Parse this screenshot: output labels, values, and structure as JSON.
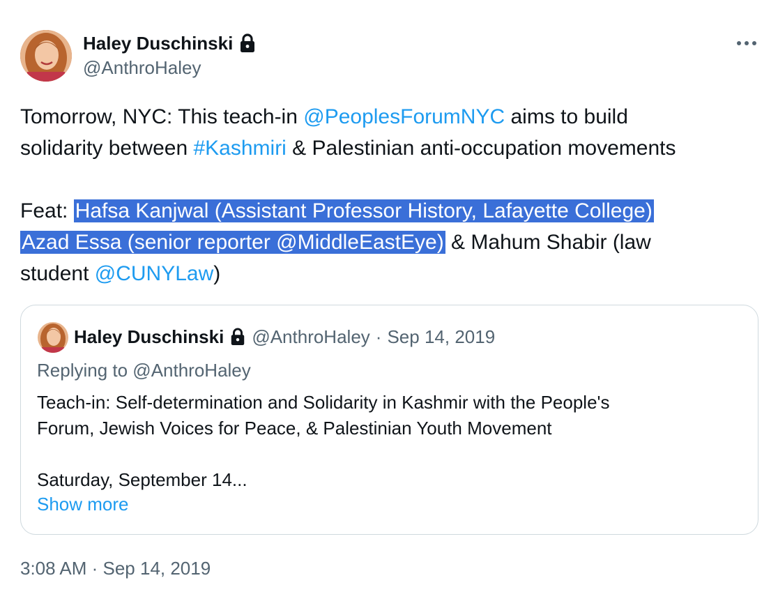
{
  "author": {
    "display_name": "Haley Duschinski",
    "handle": "@AnthroHaley",
    "protected_icon": "lock-icon",
    "avatar_icon": "avatar"
  },
  "more_icon": "more-icon",
  "tweet": {
    "line1_a": "Tomorrow, NYC: This teach-in ",
    "line1_link": "@PeoplesForumNYC",
    "line1_b": " aims to build",
    "line2_a": "solidarity between ",
    "line2_link": "#Kashmiri",
    "line2_b": " & Palestinian anti-occupation movements",
    "line4_a": "Feat: ",
    "line4_sel": "Hafsa Kanjwal (Assistant Professor History, Lafayette College)",
    "line5_sel_a": "Azad Essa (senior reporter ",
    "line5_sel_link": "@MiddleEastEye",
    "line5_sel_b": ")",
    "line5_b": " & Mahum Shabir (law",
    "line6_a": "student ",
    "line6_link": "@CUNYLaw",
    "line6_b": ")"
  },
  "quote": {
    "display_name": "Haley Duschinski",
    "handle": "@AnthroHaley",
    "separator": "·",
    "date": "Sep 14, 2019",
    "replying_to": "Replying to @AnthroHaley",
    "line1": "Teach-in: Self-determination and Solidarity in Kashmir with the People's",
    "line2": "Forum, Jewish Voices for Peace, & Palestinian Youth Movement",
    "line3": "",
    "line4": "Saturday, September 14...",
    "show_more": "Show more"
  },
  "timestamp": "3:08 AM · Sep 14, 2019",
  "colors": {
    "link": "#1d9bf0",
    "text": "#0f1419",
    "secondary": "#536471",
    "selection": "#3a6fd8",
    "border": "#cfd9de"
  }
}
